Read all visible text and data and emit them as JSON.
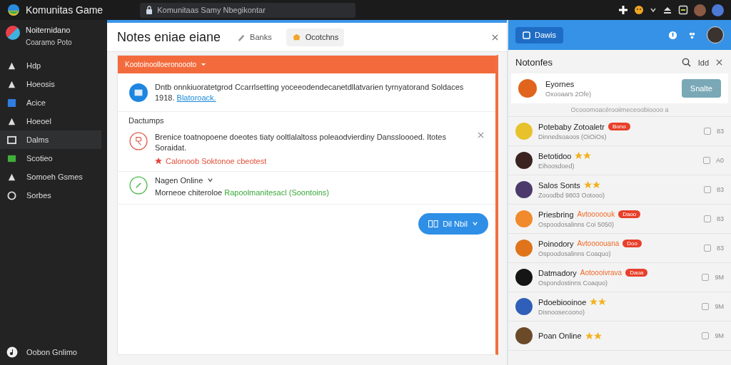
{
  "app": {
    "name": "Komunitas Game",
    "address": "Komunitaas Samy Nbegikontar"
  },
  "sidebar": {
    "profile": {
      "name": "Noiternidano",
      "subtitle": "Coaramo Poto"
    },
    "items": [
      {
        "label": "Hdp",
        "selected": false
      },
      {
        "label": "Hoeosis",
        "selected": false
      },
      {
        "label": "Acice",
        "selected": false
      },
      {
        "label": "Hoeoel",
        "selected": false
      },
      {
        "label": "Dalms",
        "selected": true
      },
      {
        "label": "Scotieo",
        "selected": false
      },
      {
        "label": "Somoeh Gsmes",
        "selected": false
      },
      {
        "label": "Sorbes",
        "selected": false
      }
    ],
    "footer": "Oobon Gnlimo"
  },
  "panel": {
    "title": "Notes eniae eiane",
    "tabs": [
      {
        "label": "Banks",
        "selected": false
      },
      {
        "label": "Ocotchns",
        "selected": true
      }
    ],
    "banner": "Kootoinoolloeronoooto",
    "announcement": {
      "text": "Dntb onnkiuoratetgrod Ccarrlsetting yoceeodendecanetdllatvarien tyrnyatorand Soldaces 1918.",
      "link": "Blatoroack."
    },
    "section": "Dactumps",
    "notifications": [
      {
        "kind": "alert",
        "text": "Brenice toatnopoene doeotes tiaty ooltlalaltoss poleaodvierdiny Danssloooed. Itotes Soraidat.",
        "warning": "Calonoob Soktonoe cbeotest",
        "dismissable": true
      },
      {
        "kind": "online",
        "title": "Nagen Online",
        "text": "Morneoe chiteroloe",
        "highlight": "Rapoolmanitesacl (Soontoins)",
        "dismissable": false
      }
    ],
    "action": "Dil Nbil"
  },
  "right": {
    "header_button": "Dawis",
    "title": "Notonfes",
    "header_link": "Idd",
    "featured": {
      "name": "Eyornes",
      "subtitle": "Oxooaars 2Ofe)",
      "button": "Snalte"
    },
    "divider": "Ocooomoacérooiimeceoobioooo a",
    "items": [
      {
        "name": "Potebaby Zotoaletr",
        "badge": "Bono",
        "starred": false,
        "subtitle": "Dinnedsoaoos (OiOiOs)",
        "checked": false,
        "count": "83"
      },
      {
        "name": "Betotidoo",
        "starred": true,
        "subtitle": "Eihoosdoed)",
        "checked": false,
        "count": "A0"
      },
      {
        "name": "Salos Sonts",
        "starred": true,
        "subtitle": "Zooodbd 9803 Ootooo)",
        "checked": false,
        "count": "83"
      },
      {
        "name": "Priesbring",
        "tag": "Avtooooouk",
        "badge": "Daoo",
        "starred": false,
        "subtitle": "Ospoodosalinns Coi 5050)",
        "checked": false,
        "count": "83"
      },
      {
        "name": "Poinodory",
        "tag": "Avtoooouana",
        "badge": "Doo",
        "starred": false,
        "subtitle": "Ospoodosalinns Coaquo)",
        "checked": false,
        "count": "83"
      },
      {
        "name": "Datmadory",
        "tag": "Aotoooivrava",
        "badge": "Daoa",
        "starred": false,
        "subtitle": "Ospondostinns Coaquo)",
        "checked": false,
        "count": "9M"
      },
      {
        "name": "Pdoebiooinoe",
        "starred": true,
        "subtitle": "Disnoosecoono)",
        "checked": false,
        "count": "9M"
      },
      {
        "name": "Poan Online",
        "starred": true,
        "checked": false,
        "count": "9M"
      }
    ]
  }
}
